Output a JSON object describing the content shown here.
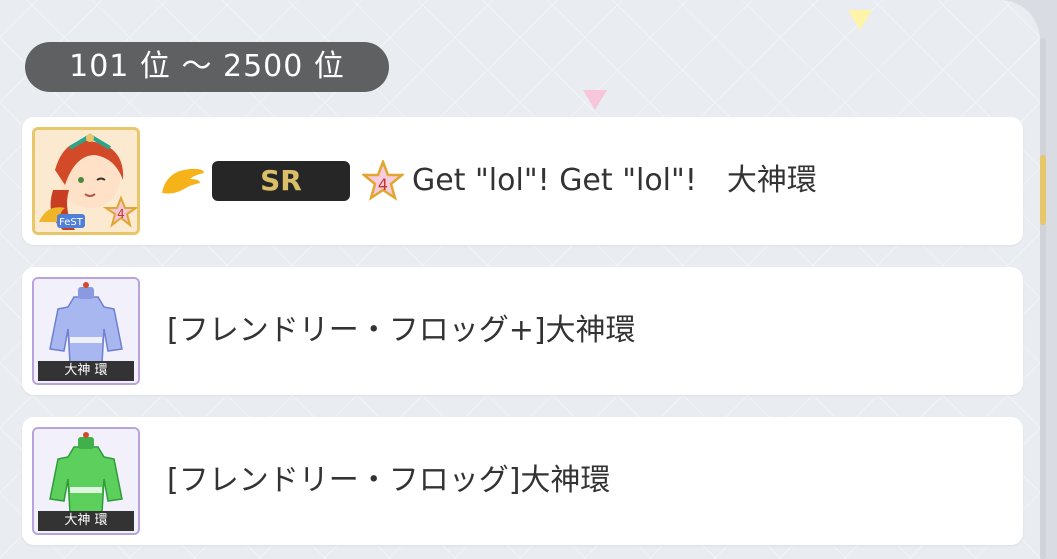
{
  "range_label": "101 位 ～ 2500 位",
  "rewards": [
    {
      "type": "card",
      "rarity": "SR",
      "star_level": "4",
      "badge_text": "FeST",
      "title": "Get \"lol\"! Get \"lol\"!　大神環",
      "icon": "card-portrait-icon"
    },
    {
      "type": "costume",
      "title": "[フレンドリー・フロッグ+]大神環",
      "name_plate": "大神 環",
      "icon": "costume-blue-icon"
    },
    {
      "type": "costume",
      "title": "[フレンドリー・フロッグ]大神環",
      "name_plate": "大神 環",
      "icon": "costume-green-icon"
    }
  ],
  "colors": {
    "pill_bg": "#5f6062",
    "rarity_bg": "#262626",
    "rarity_text": "#d9bf6a",
    "gold_frame": "#e8c66a",
    "costume_frame": "#b9a3dc"
  }
}
